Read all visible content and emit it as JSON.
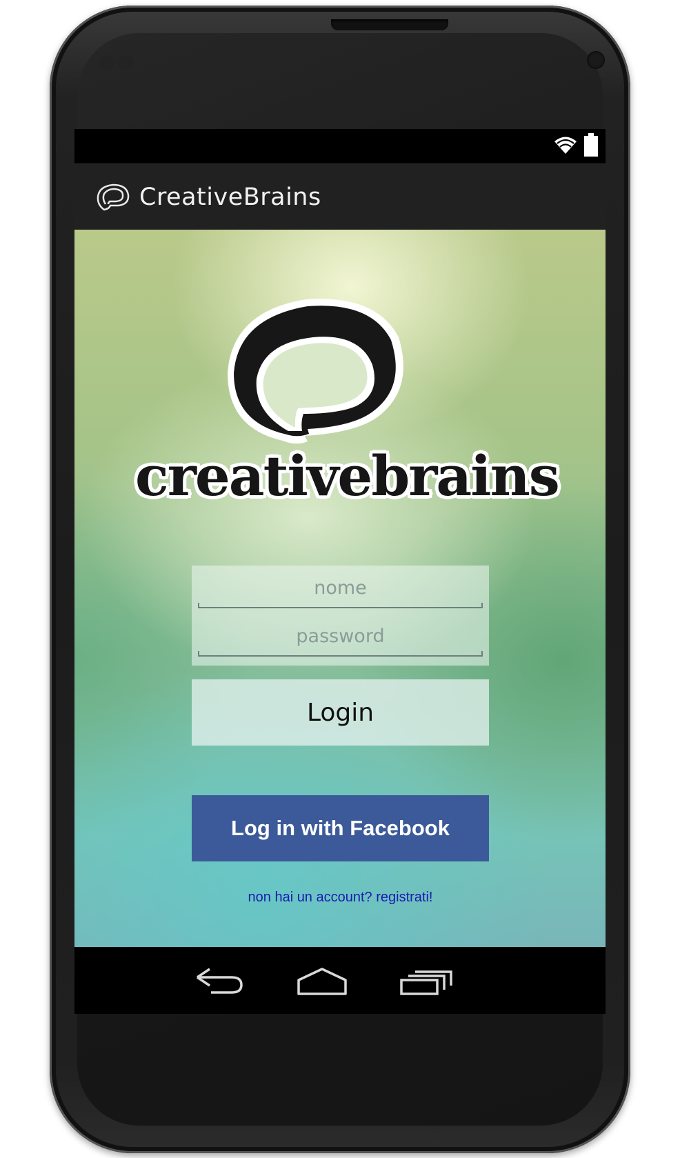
{
  "app": {
    "title": "CreativeBrains",
    "logo_wordmark": "creativebrains"
  },
  "status_bar": {
    "icons": [
      "wifi-icon",
      "battery-icon"
    ]
  },
  "login_form": {
    "name_placeholder": "nome",
    "password_placeholder": "password",
    "login_label": "Login",
    "facebook_label": "Log in with Facebook",
    "register_link": "non hai un account? registrati!"
  },
  "nav_bar": {
    "icons": [
      "back-icon",
      "home-icon",
      "recent-apps-icon"
    ]
  },
  "colors": {
    "facebook_blue": "#3c5a9a",
    "action_bar": "#212121",
    "link_blue": "#1b1bb0"
  }
}
